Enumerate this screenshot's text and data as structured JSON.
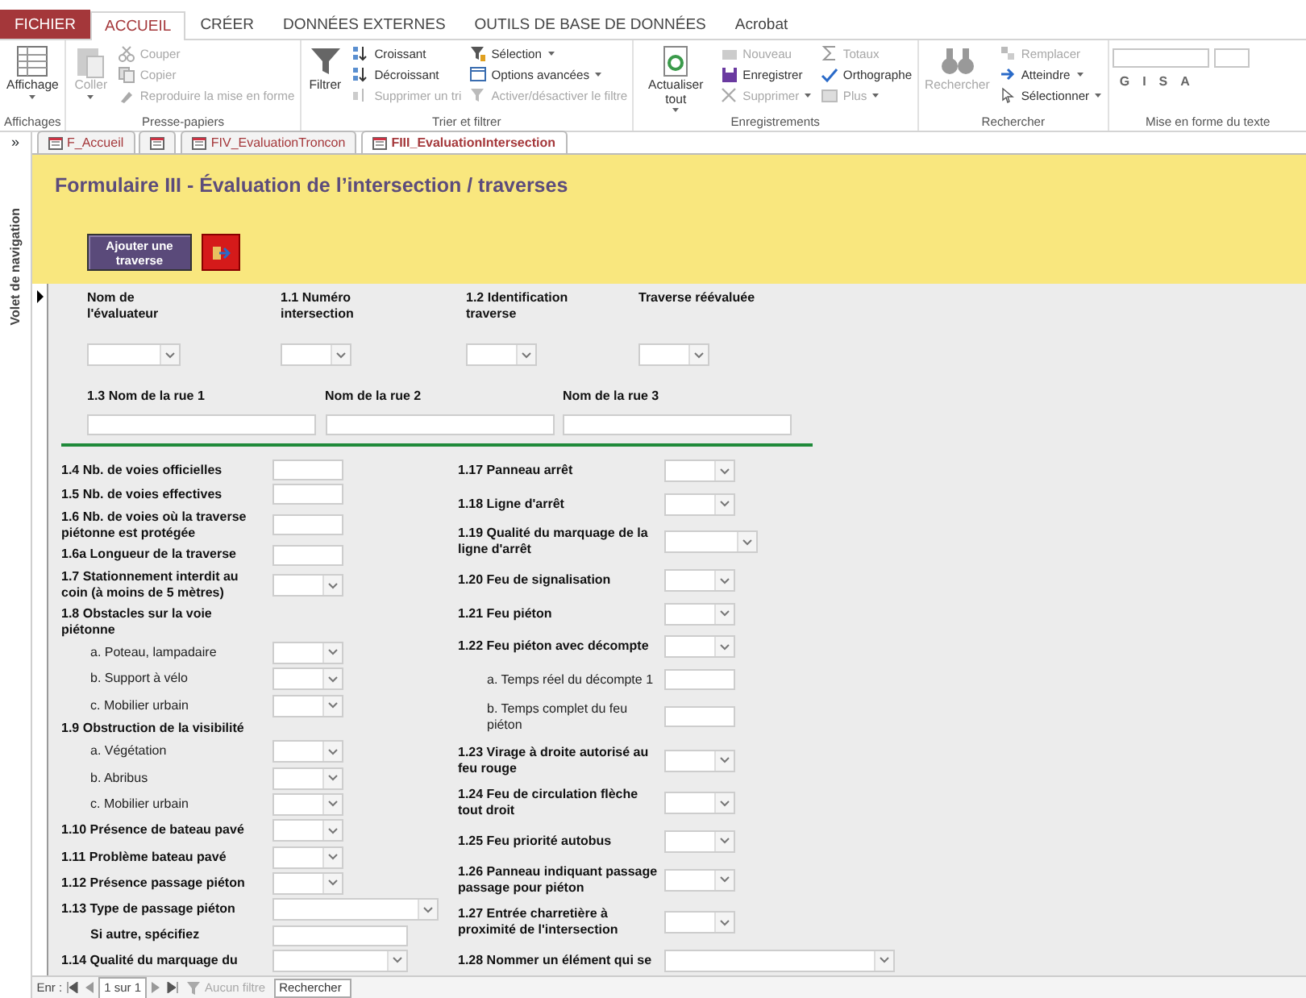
{
  "ribbon": {
    "tabs": [
      {
        "label": "FICHIER",
        "kind": "file",
        "selected": false
      },
      {
        "label": "ACCUEIL",
        "kind": "tab",
        "selected": true
      },
      {
        "label": "CRÉER",
        "kind": "tab",
        "selected": false
      },
      {
        "label": "DONNÉES EXTERNES",
        "kind": "tab",
        "selected": false
      },
      {
        "label": "OUTILS DE BASE DE DONNÉES",
        "kind": "tab",
        "selected": false
      },
      {
        "label": "Acrobat",
        "kind": "tab",
        "selected": false
      }
    ],
    "groups": [
      {
        "label": "Affichages",
        "large": [
          {
            "label": "Affichage",
            "disabled": false,
            "dropdown": true
          }
        ]
      },
      {
        "label": "Presse-papiers",
        "large": [
          {
            "label": "Coller",
            "disabled": true,
            "dropdown": true
          }
        ],
        "columns": [
          [
            {
              "label": "Couper",
              "disabled": true,
              "dropdown": false
            },
            {
              "label": "Copier",
              "disabled": true,
              "dropdown": false
            },
            {
              "label": "Reproduire la mise en forme",
              "disabled": true,
              "dropdown": false
            }
          ]
        ]
      },
      {
        "label": "Trier et filtrer",
        "large": [
          {
            "label": "Filtrer",
            "disabled": false,
            "dropdown": false
          }
        ],
        "columns": [
          [
            {
              "label": "Croissant",
              "disabled": false,
              "dropdown": false
            },
            {
              "label": "Décroissant",
              "disabled": false,
              "dropdown": false
            },
            {
              "label": "Supprimer un tri",
              "disabled": true,
              "dropdown": false
            }
          ],
          [
            {
              "label": "Sélection",
              "disabled": false,
              "dropdown": true
            },
            {
              "label": "Options avancées",
              "disabled": false,
              "dropdown": true
            },
            {
              "label": "Activer/désactiver le filtre",
              "disabled": true,
              "dropdown": false
            }
          ]
        ]
      },
      {
        "label": "Enregistrements",
        "large": [
          {
            "label": "Actualiser tout",
            "disabled": false,
            "dropdown": true
          }
        ],
        "columns": [
          [
            {
              "label": "Nouveau",
              "disabled": true,
              "dropdown": false
            },
            {
              "label": "Enregistrer",
              "disabled": false,
              "dropdown": false
            },
            {
              "label": "Supprimer",
              "disabled": true,
              "dropdown": true
            }
          ],
          [
            {
              "label": "Totaux",
              "disabled": true,
              "dropdown": false
            },
            {
              "label": "Orthographe",
              "disabled": false,
              "dropdown": false
            },
            {
              "label": "Plus",
              "disabled": true,
              "dropdown": true
            }
          ]
        ]
      },
      {
        "label": "Rechercher",
        "large": [
          {
            "label": "Rechercher",
            "disabled": true,
            "dropdown": false
          }
        ],
        "columns": [
          [
            {
              "label": "Remplacer",
              "disabled": true,
              "dropdown": false
            },
            {
              "label": "Atteindre",
              "disabled": false,
              "dropdown": true
            },
            {
              "label": "Sélectionner",
              "disabled": false,
              "dropdown": true
            }
          ]
        ]
      },
      {
        "label": "Mise en forme du texte",
        "format_buttons": [
          "G",
          "I",
          "S",
          "A"
        ]
      }
    ]
  },
  "navigation_pane": {
    "toggle": "»",
    "label": "Volet de navigation"
  },
  "document_tabs": [
    {
      "label": "F_Accueil",
      "selected": false
    },
    {
      "selected": false
    },
    {
      "label": "FIV_EvaluationTroncon",
      "selected": false
    },
    {
      "label": "FIII_EvaluationIntersection",
      "selected": true
    }
  ],
  "form": {
    "title": "Formulaire III - Évaluation de l’intersection / traverses",
    "add_button": "Ajouter une traverse",
    "header_fields": [
      {
        "label": "Nom de l'évaluateur",
        "control": {
          "kind": "combo-long"
        }
      },
      {
        "label": "1.1 Numéro intersection",
        "control": {
          "kind": "combo"
        }
      },
      {
        "label": "1.2 Identification traverse",
        "control": {
          "kind": "combo"
        }
      },
      {
        "label": "Traverse réévaluée",
        "control": {
          "kind": "combo"
        }
      }
    ],
    "street_fields": [
      {
        "label": "1.3 Nom de la rue 1"
      },
      {
        "label": "Nom de la rue 2"
      },
      {
        "label": "Nom de la rue 3"
      }
    ],
    "left_column": [
      {
        "label": "1.4 Nb. de voies officielles",
        "kind": "field",
        "control": {
          "kind": "text"
        }
      },
      {
        "label": "1.5 Nb. de voies effectives",
        "kind": "field",
        "control": {
          "kind": "text"
        }
      },
      {
        "label": "1.6 Nb. de voies où la traverse piétonne est protégée",
        "kind": "field",
        "control": {
          "kind": "text"
        }
      },
      {
        "label": "1.6a Longueur de la traverse",
        "kind": "field",
        "control": {
          "kind": "text"
        }
      },
      {
        "label": "1.7 Stationnement interdit au coin (à moins de 5 mètres)",
        "kind": "field",
        "control": {
          "kind": "combo"
        }
      },
      {
        "label": "1.8 Obstacles sur la voie piétonne",
        "kind": "heading"
      },
      {
        "label": "a. Poteau, lampadaire",
        "kind": "sub",
        "control": {
          "kind": "combo"
        }
      },
      {
        "label": "b. Support à vélo",
        "kind": "sub",
        "control": {
          "kind": "combo"
        }
      },
      {
        "label": "c. Mobilier urbain",
        "kind": "sub",
        "control": {
          "kind": "combo"
        }
      },
      {
        "label": "1.9 Obstruction de la visibilité",
        "kind": "heading"
      },
      {
        "label": "a. Végétation",
        "kind": "sub",
        "control": {
          "kind": "combo"
        }
      },
      {
        "label": "b. Abribus",
        "kind": "sub",
        "control": {
          "kind": "combo"
        }
      },
      {
        "label": "c. Mobilier urbain",
        "kind": "sub",
        "control": {
          "kind": "combo"
        }
      },
      {
        "label": "1.10 Présence de bateau pavé",
        "kind": "field",
        "control": {
          "kind": "combo"
        }
      },
      {
        "label": "1.11 Problème bateau pavé",
        "kind": "field",
        "control": {
          "kind": "combo"
        }
      },
      {
        "label": "1.12 Présence passage piéton",
        "kind": "field",
        "control": {
          "kind": "combo"
        }
      },
      {
        "label": "1.13 Type de passage piéton",
        "kind": "field",
        "control": {
          "kind": "combo-wide"
        }
      },
      {
        "label": "Si autre, spécifiez",
        "kind": "note",
        "control": {
          "kind": "text-wide"
        }
      },
      {
        "label": "1.14 Qualité du marquage du",
        "kind": "field",
        "control": {
          "kind": "combo-medium"
        }
      }
    ],
    "right_column": [
      {
        "label": "1.17 Panneau arrêt",
        "kind": "field",
        "control": {
          "kind": "combo"
        }
      },
      {
        "label": "1.18 Ligne d'arrêt",
        "kind": "field",
        "control": {
          "kind": "combo"
        }
      },
      {
        "label": "1.19 Qualité du marquage de la ligne d'arrêt",
        "kind": "field",
        "control": {
          "kind": "combo-long"
        }
      },
      {
        "label": "1.20 Feu de signalisation",
        "kind": "field",
        "control": {
          "kind": "combo"
        }
      },
      {
        "label": "1.21 Feu piéton",
        "kind": "field",
        "control": {
          "kind": "combo"
        }
      },
      {
        "label": "1.22 Feu piéton avec décompte",
        "kind": "field",
        "control": {
          "kind": "combo"
        }
      },
      {
        "label": "a. Temps réel du décompte 1",
        "kind": "sub",
        "control": {
          "kind": "text"
        }
      },
      {
        "label": "b. Temps complet du feu piéton",
        "kind": "sub",
        "control": {
          "kind": "text"
        }
      },
      {
        "label": "1.23 Virage à droite autorisé au feu rouge",
        "kind": "field",
        "control": {
          "kind": "combo"
        }
      },
      {
        "label": "1.24 Feu de circulation flèche tout droit",
        "kind": "field",
        "control": {
          "kind": "combo"
        }
      },
      {
        "label": "1.25 Feu priorité autobus",
        "kind": "field",
        "control": {
          "kind": "combo"
        }
      },
      {
        "label": "1.26 Panneau indiquant passage passage pour piéton",
        "kind": "field",
        "control": {
          "kind": "combo"
        }
      },
      {
        "label": "1.27 Entrée charretière à proximité de l'intersection",
        "kind": "field",
        "control": {
          "kind": "combo"
        }
      },
      {
        "label": "1.28 Nommer un élément qui se",
        "kind": "field",
        "control": {
          "kind": "combo-xwide"
        }
      }
    ]
  },
  "status_bar": {
    "record_label": "Enr :",
    "record_value": "1 sur 1",
    "filter": {
      "label": "Aucun filtre",
      "disabled": true
    },
    "search": {
      "placeholder": "Rechercher"
    }
  }
}
